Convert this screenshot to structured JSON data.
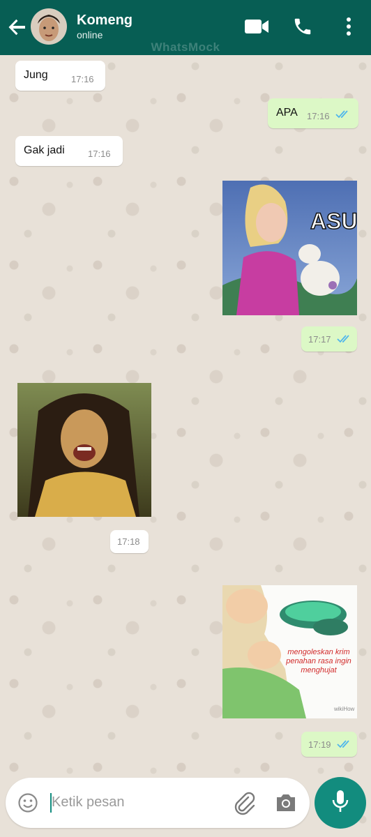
{
  "header": {
    "contact_name": "Komeng",
    "status": "online",
    "watermark": "WhatsMock"
  },
  "messages": [
    {
      "direction": "in",
      "text": "Jung",
      "time": "17:16"
    },
    {
      "direction": "out",
      "text": "APA",
      "time": "17:16",
      "read": true
    },
    {
      "direction": "in",
      "text": "Gak jadi",
      "time": "17:16"
    },
    {
      "direction": "out",
      "type": "image",
      "image_caption_text": "ASU",
      "time": "17:17",
      "read": true
    },
    {
      "direction": "in",
      "type": "image",
      "time": "17:18"
    },
    {
      "direction": "out",
      "type": "image",
      "image_caption_text": "mengoleskan krim penahan rasa ingin menghujat",
      "image_source_mark": "wikiHow",
      "time": "17:19",
      "read": true
    }
  ],
  "composer": {
    "placeholder": "Ketik pesan"
  },
  "colors": {
    "header": "#075e54",
    "outgoing_bubble": "#dcf8c6",
    "incoming_bubble": "#ffffff",
    "accent": "#128c7e",
    "read_tick": "#4fb6ec"
  },
  "icons": [
    "back-arrow-icon",
    "video-call-icon",
    "phone-icon",
    "more-options-icon",
    "emoji-icon",
    "attach-icon",
    "camera-icon",
    "mic-icon",
    "double-tick-icon"
  ]
}
